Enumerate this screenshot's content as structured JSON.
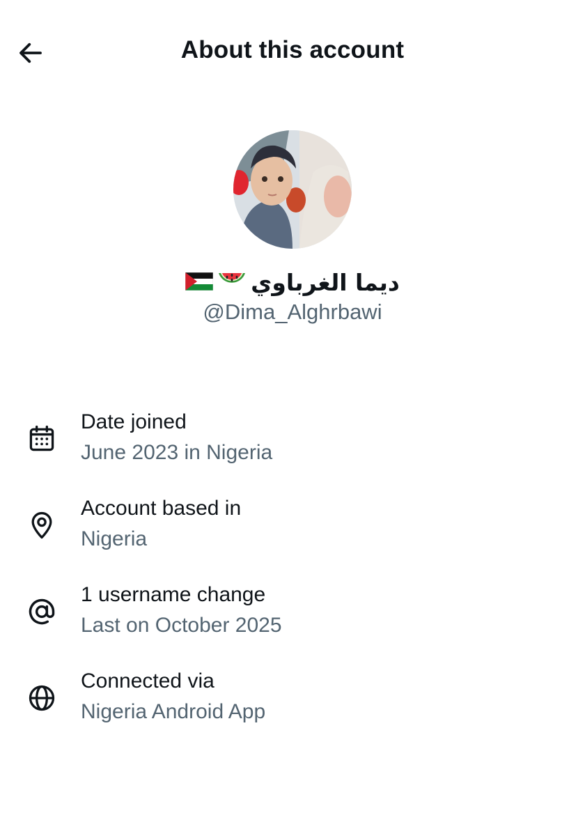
{
  "header": {
    "title": "About this account",
    "back_icon": "arrow-left-icon"
  },
  "profile": {
    "display_name": "ديما الغرباوي",
    "display_name_emojis": [
      "watermelon",
      "palestine-flag"
    ],
    "handle": "@Dima_Alghrbawi"
  },
  "info": [
    {
      "icon": "calendar-icon",
      "label": "Date joined",
      "value": "June 2023 in Nigeria"
    },
    {
      "icon": "location-pin-icon",
      "label": "Account based in",
      "value": "Nigeria"
    },
    {
      "icon": "at-sign-icon",
      "label": "1 username change",
      "value": "Last on October 2025"
    },
    {
      "icon": "globe-icon",
      "label": "Connected via",
      "value": "Nigeria Android App"
    }
  ],
  "colors": {
    "text_primary": "#0f1419",
    "text_secondary": "#536471",
    "background": "#ffffff"
  }
}
